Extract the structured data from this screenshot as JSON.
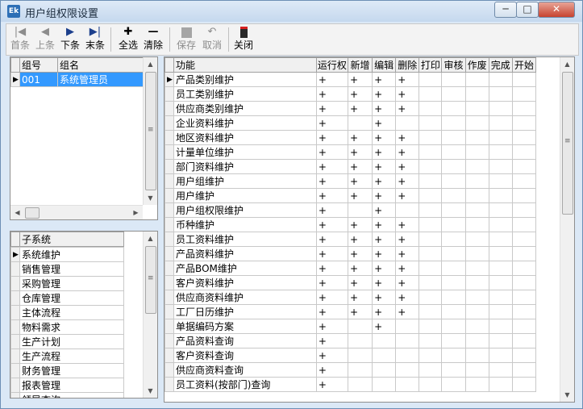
{
  "window": {
    "title": "用户组权限设置",
    "icon": "app-icon"
  },
  "toolbar": {
    "first": "首条",
    "prev": "上条",
    "next": "下条",
    "last": "末条",
    "select_all": "全选",
    "clear": "清除",
    "save": "保存",
    "cancel": "取消",
    "close": "关闭"
  },
  "groups": {
    "headers": [
      "组号",
      "组名"
    ],
    "rows": [
      {
        "id": "001",
        "name": "系统管理员",
        "selected": true
      }
    ]
  },
  "subsystems": {
    "header": "子系统",
    "items": [
      "系统维护",
      "销售管理",
      "采购管理",
      "仓库管理",
      "主体流程",
      "物料需求",
      "生产计划",
      "生产流程",
      "财务管理",
      "报表管理",
      "领导查询"
    ],
    "current_index": 0
  },
  "permissions": {
    "headers": [
      "功能",
      "运行权",
      "新增",
      "编辑",
      "删除",
      "打印",
      "审核",
      "作废",
      "完成",
      "开始"
    ],
    "mark": "+",
    "rows": [
      {
        "name": "产品类别维护",
        "perms": [
          "+",
          "+",
          "+",
          "+",
          "",
          "",
          "",
          "",
          ""
        ]
      },
      {
        "name": "员工类别维护",
        "perms": [
          "+",
          "+",
          "+",
          "+",
          "",
          "",
          "",
          "",
          ""
        ]
      },
      {
        "name": "供应商类别维护",
        "perms": [
          "+",
          "+",
          "+",
          "+",
          "",
          "",
          "",
          "",
          ""
        ]
      },
      {
        "name": "企业资料维护",
        "perms": [
          "+",
          "",
          "+",
          "",
          "",
          "",
          "",
          "",
          ""
        ]
      },
      {
        "name": "地区资料维护",
        "perms": [
          "+",
          "+",
          "+",
          "+",
          "",
          "",
          "",
          "",
          ""
        ]
      },
      {
        "name": "计量单位维护",
        "perms": [
          "+",
          "+",
          "+",
          "+",
          "",
          "",
          "",
          "",
          ""
        ]
      },
      {
        "name": "部门资料维护",
        "perms": [
          "+",
          "+",
          "+",
          "+",
          "",
          "",
          "",
          "",
          ""
        ]
      },
      {
        "name": "用户组维护",
        "perms": [
          "+",
          "+",
          "+",
          "+",
          "",
          "",
          "",
          "",
          ""
        ]
      },
      {
        "name": "用户维护",
        "perms": [
          "+",
          "+",
          "+",
          "+",
          "",
          "",
          "",
          "",
          ""
        ]
      },
      {
        "name": "用户组权限维护",
        "perms": [
          "+",
          "",
          "+",
          "",
          "",
          "",
          "",
          "",
          ""
        ]
      },
      {
        "name": "币种维护",
        "perms": [
          "+",
          "+",
          "+",
          "+",
          "",
          "",
          "",
          "",
          ""
        ]
      },
      {
        "name": "员工资料维护",
        "perms": [
          "+",
          "+",
          "+",
          "+",
          "",
          "",
          "",
          "",
          ""
        ]
      },
      {
        "name": "产品资料维护",
        "perms": [
          "+",
          "+",
          "+",
          "+",
          "",
          "",
          "",
          "",
          ""
        ]
      },
      {
        "name": "产品BOM维护",
        "perms": [
          "+",
          "+",
          "+",
          "+",
          "",
          "",
          "",
          "",
          ""
        ]
      },
      {
        "name": "客户资料维护",
        "perms": [
          "+",
          "+",
          "+",
          "+",
          "",
          "",
          "",
          "",
          ""
        ]
      },
      {
        "name": "供应商资料维护",
        "perms": [
          "+",
          "+",
          "+",
          "+",
          "",
          "",
          "",
          "",
          ""
        ]
      },
      {
        "name": "工厂日历维护",
        "perms": [
          "+",
          "+",
          "+",
          "+",
          "",
          "",
          "",
          "",
          ""
        ]
      },
      {
        "name": "单据编码方案",
        "perms": [
          "+",
          "",
          "+",
          "",
          "",
          "",
          "",
          "",
          ""
        ]
      },
      {
        "name": "产品资料查询",
        "perms": [
          "+",
          "",
          "",
          "",
          "",
          "",
          "",
          "",
          ""
        ]
      },
      {
        "name": "客户资料查询",
        "perms": [
          "+",
          "",
          "",
          "",
          "",
          "",
          "",
          "",
          ""
        ]
      },
      {
        "name": "供应商资料查询",
        "perms": [
          "+",
          "",
          "",
          "",
          "",
          "",
          "",
          "",
          ""
        ]
      },
      {
        "name": "员工资料(按部门)查询",
        "perms": [
          "+",
          "",
          "",
          "",
          "",
          "",
          "",
          "",
          ""
        ]
      }
    ]
  },
  "colors": {
    "selection": "#3399ff",
    "title_bar": "#c5d8ee",
    "close_button": "#c7432f"
  }
}
